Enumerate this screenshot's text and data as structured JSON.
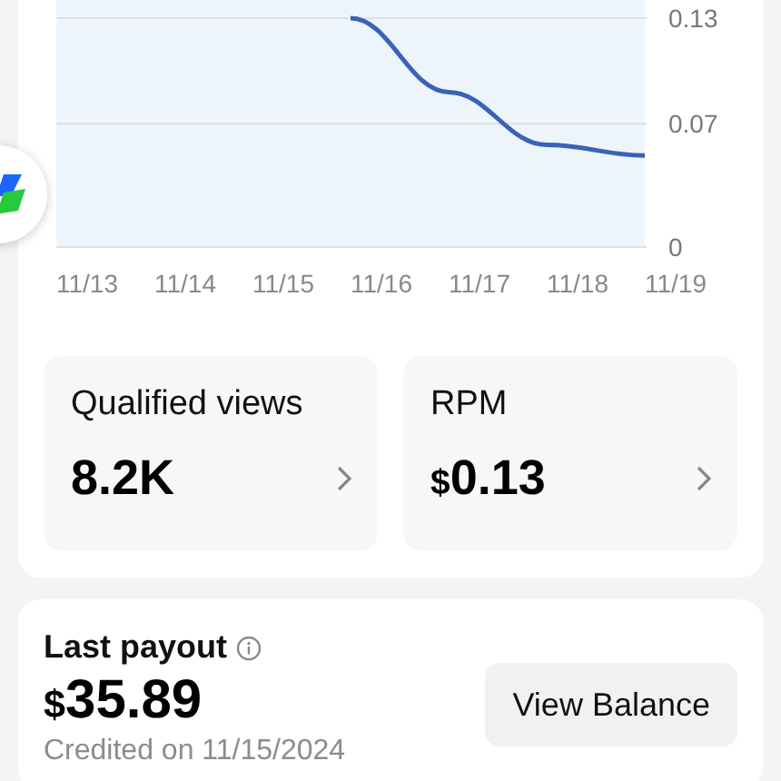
{
  "chart": {
    "chart_data": {
      "type": "line",
      "categories": [
        "11/13",
        "11/14",
        "11/15",
        "11/16",
        "11/17",
        "11/18",
        "11/19"
      ],
      "series": [
        {
          "color": "#3a62b8",
          "values": [
            null,
            null,
            null,
            0.13,
            0.088,
            0.058,
            0.052
          ]
        }
      ],
      "ylim": [
        0,
        0.13
      ],
      "yticks": [
        0,
        0.07,
        {
          "value": 0.13,
          "label": "0.13"
        }
      ]
    }
  },
  "stats": [
    {
      "label": "Qualified views",
      "value": "8.2K"
    },
    {
      "label": "RPM",
      "currency": "$",
      "value": "0.13"
    }
  ],
  "payout": {
    "title": "Last payout",
    "currency": "$",
    "amount": "35.89",
    "note": "Credited on 11/15/2024",
    "button": "View Balance"
  }
}
